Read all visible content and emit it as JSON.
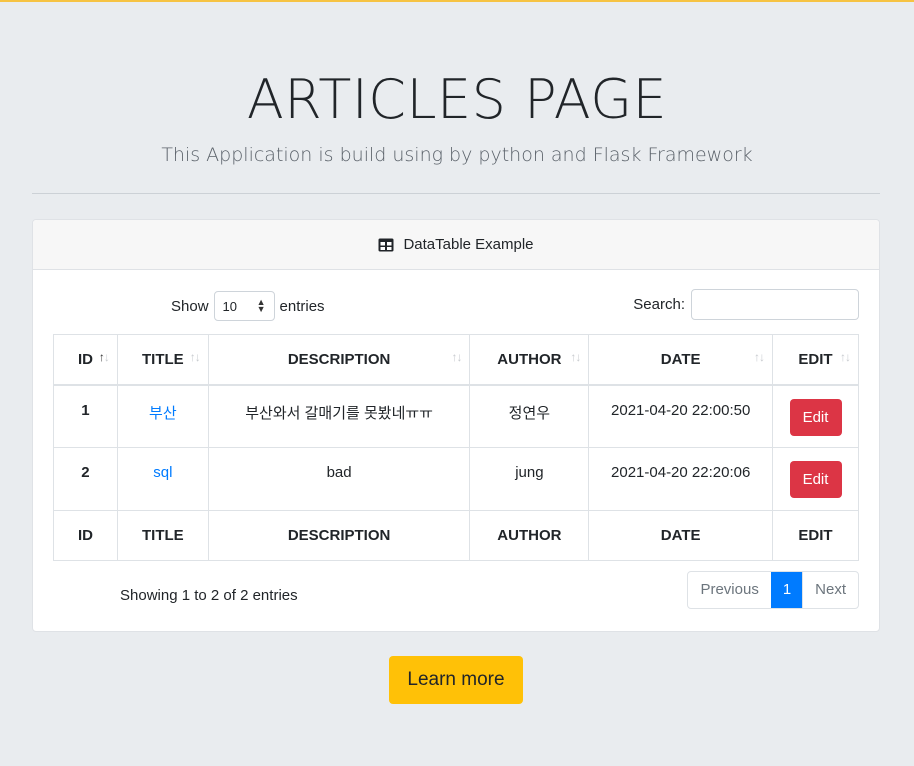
{
  "header": {
    "title": "ARTICLES PAGE",
    "lead": "This Application is build using by python and Flask Framework"
  },
  "card": {
    "title": "DataTable Example",
    "icon": "table-icon",
    "show_label": "Show",
    "entries_value": "10",
    "entries_label": "entries",
    "search_label": "Search:",
    "search_value": ""
  },
  "table": {
    "columns": [
      "ID",
      "TITLE",
      "DESCRIPTION",
      "AUTHOR",
      "DATE",
      "EDIT"
    ],
    "rows": [
      {
        "id": "1",
        "title": "부산",
        "description": "부산와서 갈매기를 못봤네ㅠㅠ",
        "author": "정연우",
        "date": "2021-04-20 22:00:50",
        "edit": "Edit"
      },
      {
        "id": "2",
        "title": "sql",
        "description": "bad",
        "author": "jung",
        "date": "2021-04-20 22:20:06",
        "edit": "Edit"
      }
    ],
    "sorted_column": "ID"
  },
  "footer": {
    "info": "Showing 1 to 2 of 2 entries",
    "pager": {
      "previous": "Previous",
      "current": "1",
      "next": "Next"
    }
  },
  "learn_more": "Learn more",
  "colors": {
    "accent": "#007bff",
    "danger": "#dc3545",
    "warning": "#ffc107",
    "background": "#e9ecef"
  }
}
